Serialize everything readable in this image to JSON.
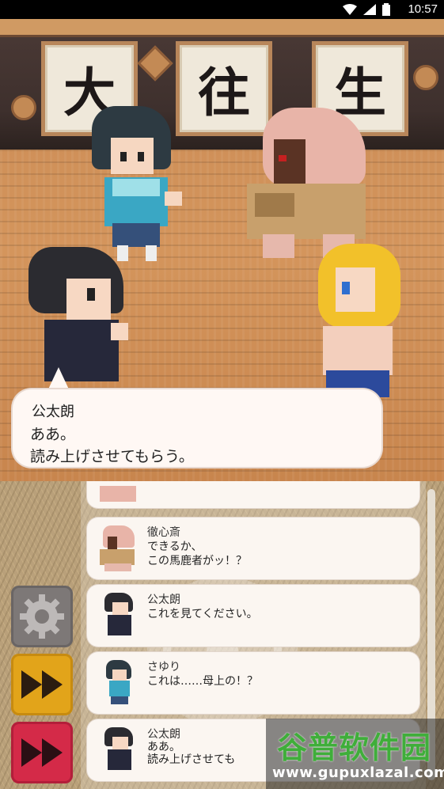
{
  "status_bar": {
    "time": "10:57",
    "icons": [
      "wifi-icon",
      "signal-icon",
      "battery-icon"
    ]
  },
  "scene": {
    "scroll_chars": [
      "大",
      "往",
      "生"
    ]
  },
  "dialogue": {
    "speaker": "公太朗",
    "lines": [
      "ああ。",
      "読み上げさせてもらう。"
    ]
  },
  "log": {
    "entries": [
      {
        "speaker": "徹心斎",
        "lines": [
          "できるか、",
          "この馬鹿者がッ！？"
        ],
        "portrait": "tesshinsai-portrait"
      },
      {
        "speaker": "公太朗",
        "lines": [
          "これを見てください。"
        ],
        "portrait": "kotaro-portrait"
      },
      {
        "speaker": "さゆり",
        "lines": [
          "これは……母上の！？"
        ],
        "portrait": "sayuri-portrait"
      },
      {
        "speaker": "公太朗",
        "lines": [
          "ああ。",
          "読み上げさせても"
        ],
        "portrait": "kotaro-portrait"
      }
    ]
  },
  "controls": {
    "settings_icon": "gear-icon",
    "fast_forward_icon": "fast-forward-icon",
    "skip_icon": "skip-icon",
    "colors": {
      "settings": "#7d7877",
      "fast_forward": "#e2a41a",
      "skip": "#d42a48"
    }
  },
  "watermark": {
    "title": "谷普软件园",
    "url": "www.gupuxlazal.com"
  }
}
